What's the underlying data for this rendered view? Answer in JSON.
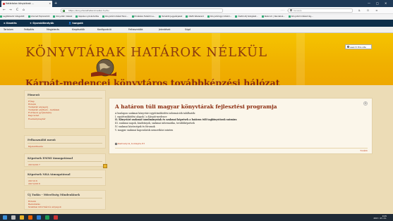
{
  "browser": {
    "tab_title": "Határ​talan ... (tab)",
    "tab_title_full": "Határtalan könyvtárak ...",
    "new_tab_label": "+",
    "url": "https://konyvtarakhataroknelkul.hu/hu",
    "search_placeholder": "Keresés",
    "nav_back": "←",
    "nav_forward": "→",
    "nav_reload": "C",
    "nav_home": "⌂",
    "url_actions": "··· ☆",
    "right_icons": "⇊ ⊡ ≡",
    "win_min": "—",
    "win_max": "□",
    "win_close": "✕"
  },
  "bookmarks": [
    "Legtöbbször látogatott",
    "Internet Explorerből",
    "Könyvtári Intézet",
    "Képzési nyilvántartás",
    "Könyvtári Intézet Tanú...",
    "Emlékére Felkérő La...",
    "Temetők Jegyzékjeket",
    "OSZK tételszerű",
    "Könyvtárügyi Intézm...",
    "Ösztöndíj Szolgálat...",
    "Webcom | Rendelvé...",
    "Könyvtári Intézet rég..."
  ],
  "admin_bar": {
    "menu": "≡ Kezelés",
    "shortcuts": "★ Gyorsbillentyűk",
    "user": "👤 hangoló"
  },
  "admin_menu": {
    "items": [
      "Tartalom",
      "Felépítés",
      "Megjelenés",
      "Kiegészítők",
      "Konfiguráció",
      "Felhasználók",
      "Jelentések",
      "Súgó"
    ]
  },
  "site": {
    "title": "KÖNYVTÁRAK HATÁROK NÉLKÜL",
    "slogan": "Kárpát-medencei könyvtáros továbbképzési hálózat",
    "search_label": "search this site"
  },
  "sidebar": {
    "blocks": [
      {
        "title": "Főmenü",
        "items": [
          "Főlap",
          "Rólunk",
          "Tudástár anyagok",
          "Tudástár elérhető - kellékek",
          "Források gyűjtemény",
          "Kapcsolat",
          "Eseménynaptár"
        ]
      },
      {
        "title": "Felhasználói menü",
        "items": [
          "Kijelentkezés"
        ]
      },
      {
        "title": "Képzések EMMI támogatással",
        "items": [
          "2016/2017"
        ]
      },
      {
        "title": "Képzések NKA támogatással",
        "items": [
          "2015/16",
          "2015/2016"
        ]
      },
      {
        "title": "Új Tudás - Műveltség Mindenkinek",
        "items": [
          "Rólunk",
          "Bemutatás",
          "Szakmai információs anyagok"
        ]
      }
    ]
  },
  "content": {
    "title": "A határon túli magyar könyvtárak fejlesztési programja",
    "lines": [
      "A honlapon szakmai könyvtári együttműködési információk találhatók:",
      "I. együttműködési alapok | a Kárpát-medence",
      "II. Könyvtári szakmai tanulmányutak és szakmai képzések a határon túli tagkönyvtárak számára",
      "III. szakmai napok, kiadványok, szakmai informatika, továbbképzések",
      "IV. szakmai közösségek és fórumok",
      "V. magyar szakmai kapcsolatok nemzetközi szinten"
    ],
    "attachment": "kiadvanyok_honlapra.rtf",
    "more": "Tovább",
    "gear_icon": "⚙"
  },
  "taskbar": {
    "time": "9:45",
    "date": "2017. 03. 21."
  }
}
